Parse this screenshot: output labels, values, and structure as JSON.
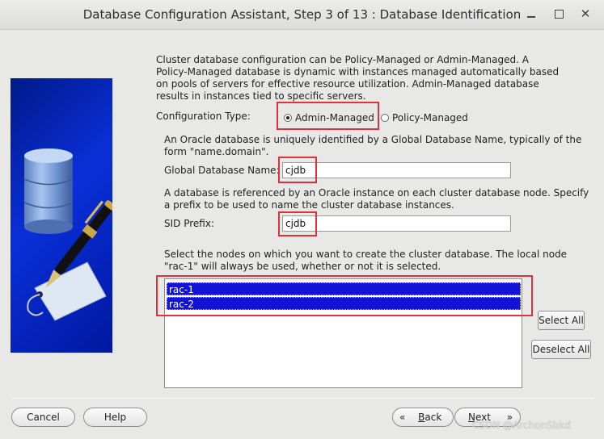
{
  "window": {
    "title": "Database Configuration Assistant, Step 3 of 13 : Database Identification",
    "controls": {
      "minimize": "",
      "maximize": "",
      "close": "✕"
    }
  },
  "intro_text": "Cluster database configuration can be Policy-Managed or Admin-Managed. A Policy-Managed database is dynamic with instances managed automatically based on pools of servers for effective resource utilization. Admin-Managed database results in instances tied to specific servers.",
  "config_type": {
    "label": "Configuration Type:",
    "options": [
      {
        "label": "Admin-Managed",
        "selected": true
      },
      {
        "label": "Policy-Managed",
        "selected": false
      }
    ]
  },
  "global_db": {
    "description": "An Oracle database is uniquely identified by a Global Database Name, typically of the form \"name.domain\".",
    "label": "Global Database Name:",
    "value": "cjdb"
  },
  "sid": {
    "description": "A database is referenced by an Oracle instance on each cluster database node. Specify a prefix to be used to name the cluster database instances.",
    "label": "SID Prefix:",
    "value": "cjdb"
  },
  "nodes": {
    "description": "Select the nodes on which you want to create the cluster database. The local node \"rac-1\" will always be used, whether or not it is selected.",
    "items": [
      "rac-1",
      "rac-2"
    ],
    "select_all_label": "Select All",
    "deselect_all_label": "Deselect All"
  },
  "footer": {
    "cancel_label": "Cancel",
    "help_label": "Help",
    "back_label": "Back",
    "next_label": "Next",
    "back_mnemonic": "B",
    "next_mnemonic": "N"
  },
  "watermark": "CSDN @ArchonSbkd",
  "colors": {
    "selection": "#1313d6",
    "highlight_box": "#e0303a",
    "banner": "#0a2fd8"
  }
}
